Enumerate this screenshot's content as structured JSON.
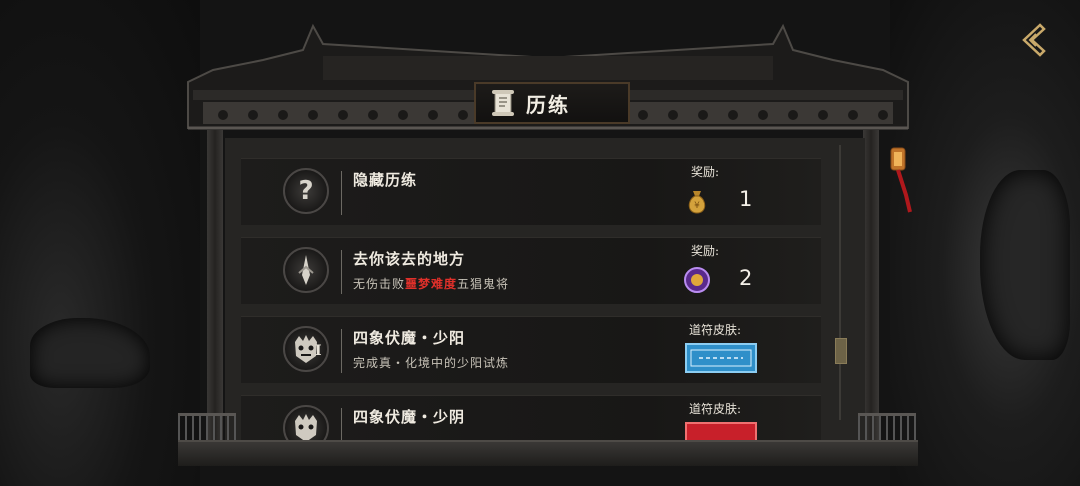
{
  "header": {
    "title": "历练",
    "title_icon": "scroll-icon"
  },
  "nav": {
    "back_icon": "back-arrow-icon"
  },
  "achievements": [
    {
      "title": "隐藏历练",
      "description": "",
      "icon": "question-icon",
      "reward_label": "奖励:",
      "reward_icon": "money-bag-icon",
      "reward_count": "1"
    },
    {
      "title": "去你该去的地方",
      "description_prefix": "无伤击败",
      "description_highlight": "噩梦难度",
      "description_suffix": "五猖鬼将",
      "icon": "spear-icon",
      "reward_label": "奖励:",
      "reward_icon": "purple-coin-icon",
      "reward_count": "2"
    },
    {
      "title": "四象伏魔・少阳",
      "description": "完成真・化境中的少阳试炼",
      "icon": "demon-mask-icon",
      "reward_label": "道符皮肤:",
      "reward_skin_color": "#2f8fc9"
    },
    {
      "title": "四象伏魔・少阴",
      "description": "",
      "icon": "demon-mask-icon",
      "reward_label": "道符皮肤:",
      "reward_skin_color": "#c8202a"
    }
  ],
  "colors": {
    "highlight": "#e0302a",
    "panel": "#262523",
    "roof": "#1c1b1a"
  }
}
